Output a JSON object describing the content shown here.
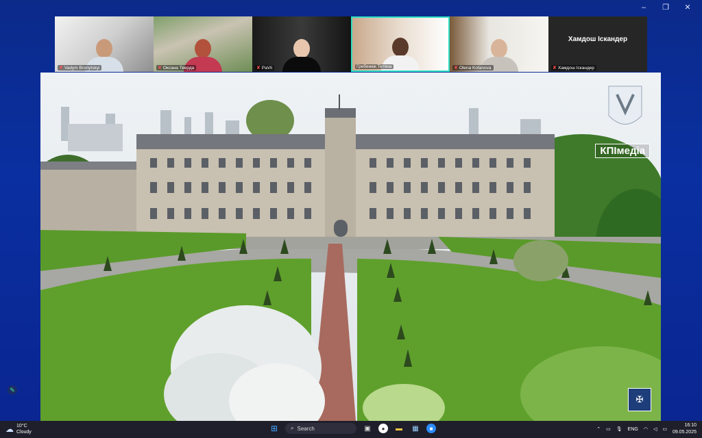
{
  "window": {
    "minimize": "–",
    "restore": "❐",
    "close": "✕"
  },
  "participants": [
    {
      "name": "Vadym Bronytskyi",
      "muted": true
    },
    {
      "name": "Оксана Тверда",
      "muted": true
    },
    {
      "name": "PaVli",
      "muted": true
    },
    {
      "name": "Гребенюк Тетяна",
      "muted": false,
      "active": true
    },
    {
      "name": "Olena Kofanova",
      "muted": true
    },
    {
      "name": "Хамдош Іскандер",
      "muted": true,
      "display": "Хамдош Іскандер"
    }
  ],
  "stage": {
    "watermark": "КПІмедіа",
    "corner_logo": "✠"
  },
  "taskbar": {
    "weather_temp": "10°C",
    "weather_desc": "Cloudy",
    "search_placeholder": "Search",
    "lang": "ENG",
    "time": "16:10",
    "date": "09.05.2025"
  },
  "colors": {
    "active_border": "#2ee0c6",
    "mic_muted": "#ff5050",
    "grass": "#5fa02c"
  }
}
